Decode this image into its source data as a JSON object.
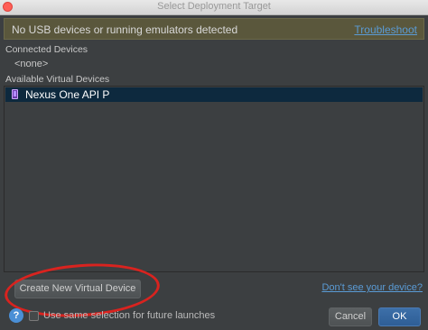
{
  "window": {
    "title": "Select Deployment Target"
  },
  "banner": {
    "message": "No USB devices or running emulators detected",
    "link": "Troubleshoot"
  },
  "connected": {
    "label": "Connected Devices",
    "none": "<none>"
  },
  "available": {
    "label": "Available Virtual Devices",
    "devices": [
      {
        "name": "Nexus One API P",
        "selected": true
      }
    ]
  },
  "footer": {
    "create_button": "Create New Virtual Device",
    "help_link": "Don't see your device?",
    "help_icon": "?",
    "checkbox_label": "Use same selection for future launches",
    "checkbox_checked": false,
    "cancel_button": "Cancel",
    "ok_button": "OK"
  },
  "colors": {
    "background": "#3c3f41",
    "banner": "#5a573c",
    "selection": "#0d293e",
    "link": "#5a9bd5",
    "annotation": "#d9231f"
  }
}
